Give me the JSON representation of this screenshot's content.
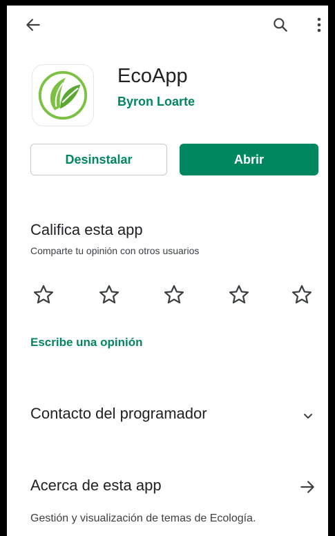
{
  "app": {
    "name": "EcoApp",
    "developer": "Byron Loarte",
    "brand_color": "#01875f"
  },
  "icons": {
    "back": "arrow-back-icon",
    "search": "search-icon",
    "more": "more-vert-icon",
    "app_logo": "leaf-logo-icon",
    "expand": "chevron-down-icon",
    "navigate": "arrow-forward-icon"
  },
  "actions": {
    "uninstall_label": "Desinstalar",
    "open_label": "Abrir"
  },
  "rating": {
    "title": "Califica esta app",
    "subtitle": "Comparte tu opinión con otros usuarios",
    "stars_total": 5,
    "stars_selected": 0,
    "write_review_label": "Escribe una opinión"
  },
  "sections": {
    "contact_title": "Contacto del programador",
    "about_title": "Acerca de esta app",
    "about_description": "Gestión y visualización de temas de Ecología."
  }
}
